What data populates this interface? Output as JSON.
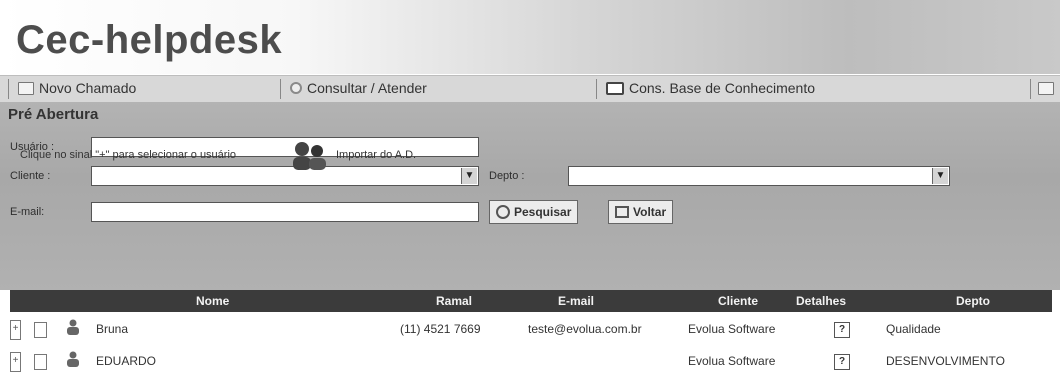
{
  "app": {
    "title": "Cec-helpdesk"
  },
  "menu": {
    "items": [
      {
        "label": "Novo Chamado",
        "icon": "document-icon"
      },
      {
        "label": "Consultar / Atender",
        "icon": "search-icon"
      },
      {
        "label": "Cons. Base de Conhecimento",
        "icon": "book-icon"
      }
    ]
  },
  "panel": {
    "title": "Pré Abertura",
    "usuario_label": "Usuário :",
    "usuario_value": "",
    "cliente_label": "Cliente :",
    "cliente_value": "",
    "depto_label": "Depto :",
    "depto_value": "",
    "email_label": "E-mail:",
    "email_value": "",
    "search_label": "Pesquisar",
    "back_label": "Voltar",
    "hint": "Clique no sinal \"+\" para selecionar o usuário",
    "import_label": "Importar do A.D."
  },
  "table": {
    "headers": [
      "Nome",
      "Ramal",
      "E-mail",
      "Cliente",
      "Detalhes",
      "Depto"
    ],
    "rows": [
      {
        "expand": "+",
        "nome": "Bruna",
        "ramal": "(11) 4521 7669",
        "email": "teste@evolua.com.br",
        "cliente": "Evolua Software",
        "detalhe": "?",
        "depto": "Qualidade"
      },
      {
        "expand": "+",
        "nome": "EDUARDO",
        "ramal": "",
        "email": "",
        "cliente": "Evolua Software",
        "detalhe": "?",
        "depto": "DESENVOLVIMENTO"
      }
    ]
  },
  "colors": {
    "header_dark": "#3b3b3b",
    "panel_gray": "#b0b0b0",
    "menu_gray": "#d8d8d8"
  }
}
